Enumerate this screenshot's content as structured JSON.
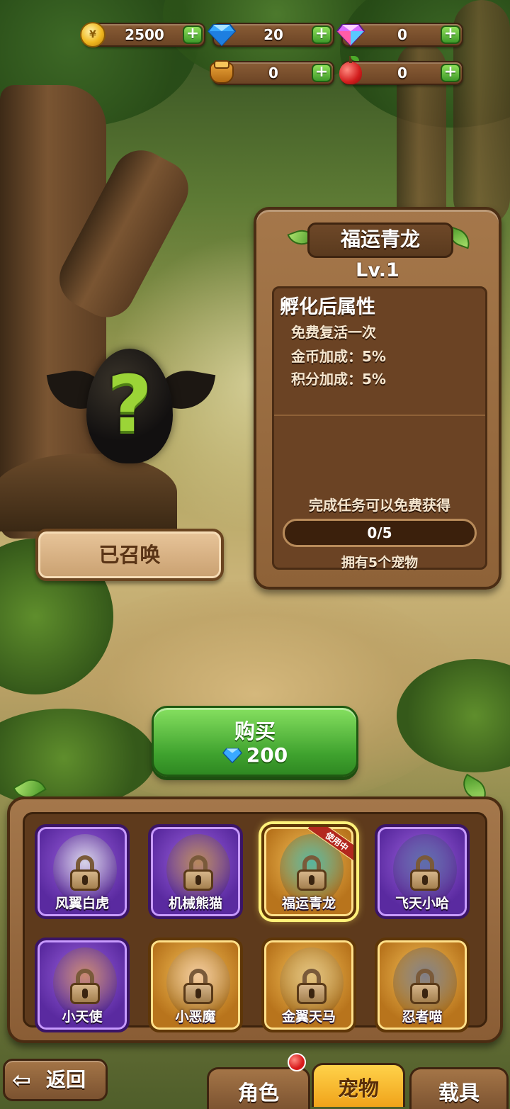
{
  "resources": {
    "coins": "2500",
    "diamonds": "20",
    "crystals": "0",
    "honey": "0",
    "apples": "0",
    "coin_symbol": "¥"
  },
  "pet_panel": {
    "title": "福运青龙",
    "level": "Lv.1",
    "attr_heading": "孵化后属性",
    "attributes": [
      "免费复活一次",
      "金币加成：5%",
      "积分加成：5%"
    ],
    "task_note": "完成任务可以免费获得",
    "progress_text": "0/5",
    "progress_value": 0,
    "progress_max": 5,
    "own_note": "拥有5个宠物"
  },
  "mystery_egg": {
    "symbol": "?"
  },
  "summon_button": "已召唤",
  "buy_button": {
    "label": "购买",
    "price": "200"
  },
  "pets": [
    {
      "name": "风翼白虎",
      "rarity": "purple",
      "locked": true
    },
    {
      "name": "机械熊猫",
      "rarity": "purple",
      "locked": true
    },
    {
      "name": "福运青龙",
      "rarity": "gold",
      "locked": true,
      "selected": true,
      "badge": "使用中"
    },
    {
      "name": "飞天小哈",
      "rarity": "purple",
      "locked": true
    },
    {
      "name": "小天使",
      "rarity": "purple",
      "locked": true
    },
    {
      "name": "小恶魔",
      "rarity": "gold",
      "locked": true
    },
    {
      "name": "金翼天马",
      "rarity": "gold",
      "locked": true
    },
    {
      "name": "忍者喵",
      "rarity": "gold",
      "locked": true
    }
  ],
  "nav": {
    "back": "返回",
    "back_arrow": "⇦",
    "tabs": [
      "角色",
      "宠物",
      "载具"
    ],
    "active_tab": "宠物"
  },
  "colors": {
    "wood": "#8e6238",
    "green_button": "#3fa22e",
    "purple_card": "#5a2aa0",
    "gold_card": "#b8741c",
    "accent_yellow": "#ffd24a"
  }
}
